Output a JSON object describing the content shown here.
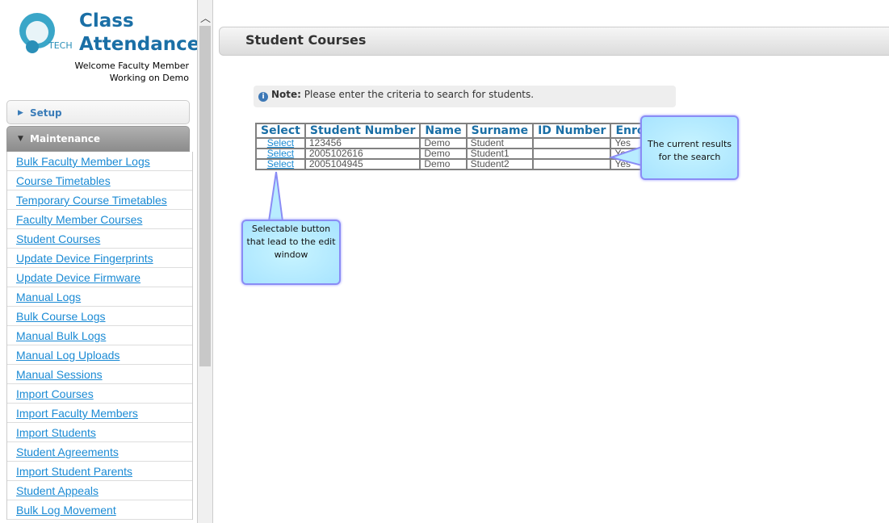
{
  "app": {
    "title_line1": "Class",
    "title_line2": "Attendance",
    "logo_text": "TECH",
    "welcome": "Welcome Faculty Member",
    "working_on": "Working on Demo"
  },
  "sidebar": {
    "setup": "Setup",
    "maintenance": "Maintenance",
    "items": [
      "Bulk Faculty Member Logs",
      "Course Timetables",
      "Temporary Course Timetables",
      "Faculty Member Courses",
      "Student Courses",
      "Update Device Fingerprints",
      "Update Device Firmware",
      "Manual Logs",
      "Bulk Course Logs",
      "Manual Bulk Logs",
      "Manual Log Uploads",
      "Manual Sessions",
      "Import Courses",
      "Import Faculty Members",
      "Import Students",
      "Student Agreements",
      "Import Student Parents",
      "Student Appeals",
      "Bulk Log Movement"
    ]
  },
  "main": {
    "page_title": "Student Courses",
    "note_label": "Note:",
    "note_text": "Please enter the criteria to search for students.",
    "table": {
      "headers": [
        "Select",
        "Student Number",
        "Name",
        "Surname",
        "ID Number",
        "Enrolled"
      ],
      "rows": [
        [
          "Select",
          "123456",
          "Demo",
          "Student",
          "",
          "Yes"
        ],
        [
          "Select",
          "2005102616",
          "Demo",
          "Student1",
          "",
          "Yes"
        ],
        [
          "Select",
          "2005104945",
          "Demo",
          "Student2",
          "",
          "Yes"
        ]
      ]
    }
  },
  "callouts": {
    "results": "The current results for the search",
    "select": "Selectable button that lead to the edit window"
  }
}
